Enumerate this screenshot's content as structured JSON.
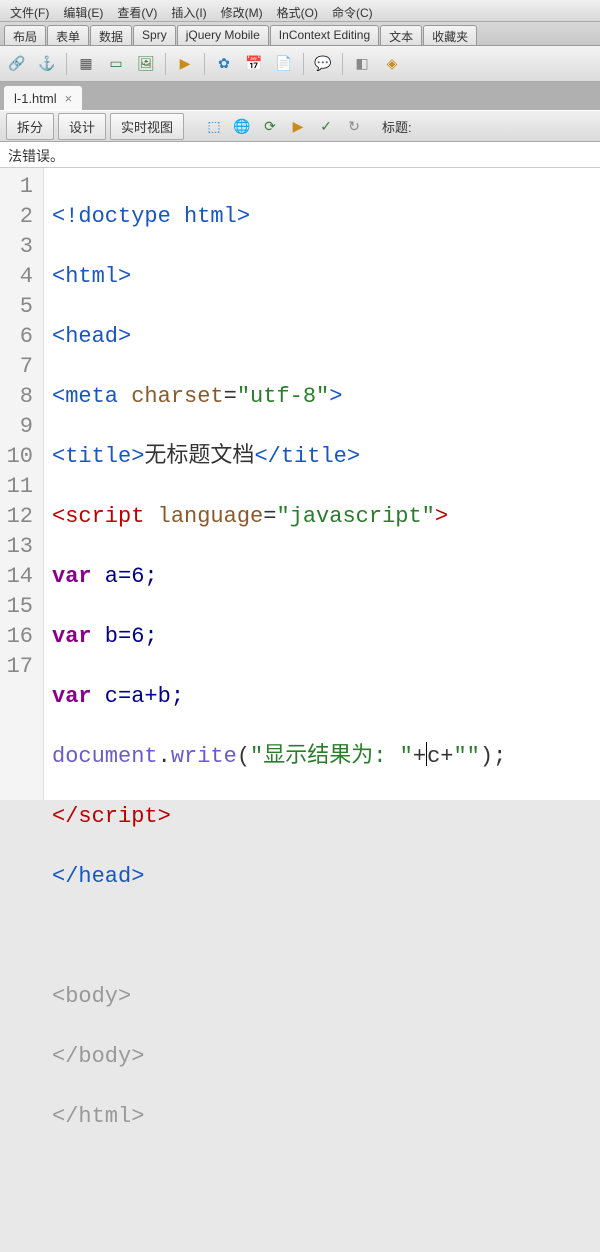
{
  "menubar": {
    "items": [
      "文件(F)",
      "编辑(E)",
      "查看(V)",
      "插入(I)",
      "修改(M)",
      "格式(O)",
      "命令(C)"
    ]
  },
  "tabbar": {
    "tabs": [
      "布局",
      "表单",
      "数据",
      "Spry",
      "jQuery Mobile",
      "InContext Editing",
      "文本",
      "收藏夹"
    ]
  },
  "file_tabs": {
    "active": {
      "name": "l-1.html",
      "close": "×"
    }
  },
  "view_toolbar": {
    "btn_split": "拆分",
    "btn_design": "设计",
    "btn_live": "实时视图",
    "title_label": "标题:"
  },
  "error_bar": {
    "text": "法错误。"
  },
  "code": {
    "lines": [
      "1",
      "2",
      "3",
      "4",
      "5",
      "6",
      "7",
      "8",
      "9",
      "10",
      "11",
      "12",
      "13",
      "14",
      "15",
      "16",
      "17"
    ],
    "l1_a": "<!doctype html>",
    "l2_a": "<html>",
    "l3_a": "<head>",
    "l4_a": "<meta ",
    "l4_b": "charset",
    "l4_c": "=",
    "l4_d": "\"utf-8\"",
    "l4_e": ">",
    "l5_a": "<title>",
    "l5_b": "无标题文档",
    "l5_c": "</title>",
    "l6_a": "<script ",
    "l6_b": "language",
    "l6_c": "=",
    "l6_d": "\"javascript\"",
    "l6_e": ">",
    "l7_a": "var",
    "l7_b": " a=6;",
    "l8_a": "var",
    "l8_b": " b=6;",
    "l9_a": "var",
    "l9_b": " c=a+b;",
    "l10_a": "document",
    "l10_b": ".",
    "l10_c": "write",
    "l10_d": "(",
    "l10_e": "\"显示结果为: \"",
    "l10_f": "+",
    "l10_g": "c+",
    "l10_h": "\"\"",
    "l10_i": ");",
    "l11_a": "</scr",
    "l11_b": "ipt>",
    "l12_a": "</head>",
    "l14_a": "<body>",
    "l15_a": "</body>",
    "l16_a": "</html>"
  }
}
